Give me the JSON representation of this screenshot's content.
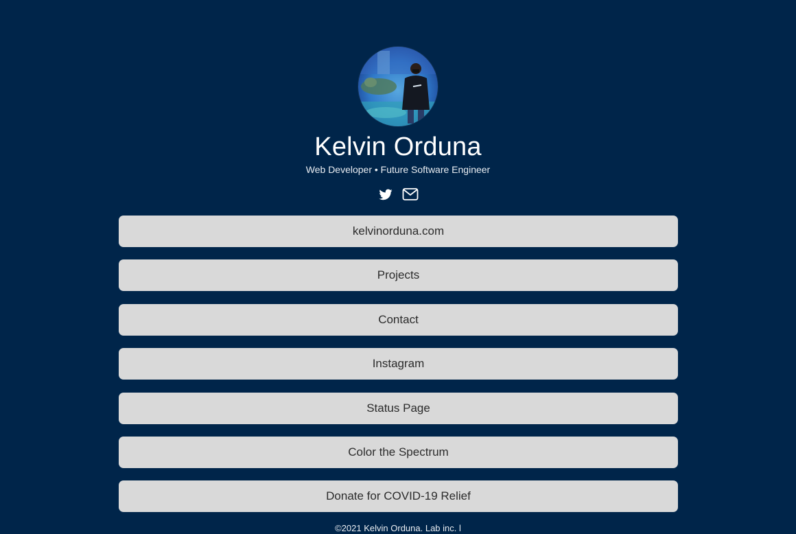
{
  "profile": {
    "name": "Kelvin Orduna",
    "tagline": "Web Developer • Future Software Engineer",
    "avatar_alt": "profile photo"
  },
  "social": [
    {
      "icon": "twitter-icon",
      "label": "Twitter"
    },
    {
      "icon": "mail-icon",
      "label": "Email"
    }
  ],
  "links": [
    "kelvinorduna.com",
    "Projects",
    "Contact",
    "Instagram",
    "Status Page",
    "Color the Spectrum",
    "Donate for COVID-19 Relief"
  ],
  "footer": {
    "text": "©2021 Kelvin Orduna. Lab inc. l"
  },
  "colors": {
    "background": "#00254a",
    "button": "#d9d9d9",
    "button_text": "#2b2b2b"
  }
}
